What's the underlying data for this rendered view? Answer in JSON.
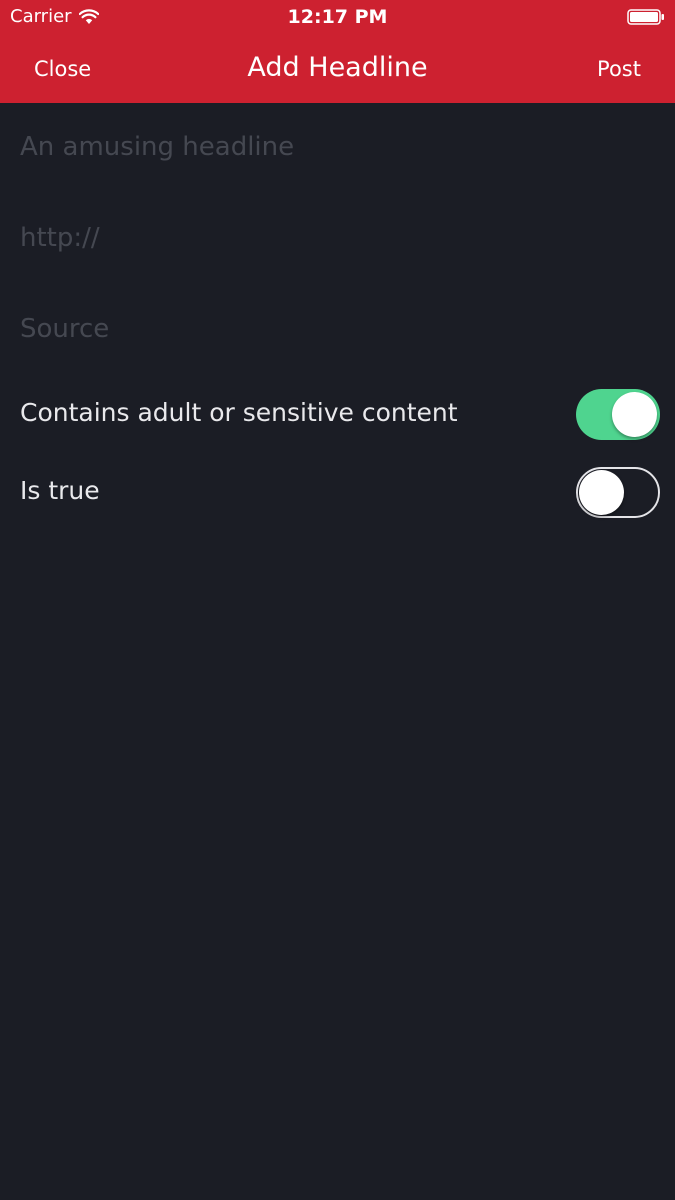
{
  "status_bar": {
    "carrier": "Carrier",
    "time": "12:17 PM",
    "wifi_icon": "wifi-icon",
    "battery_icon": "battery-icon"
  },
  "nav": {
    "close_label": "Close",
    "title": "Add Headline",
    "post_label": "Post"
  },
  "form": {
    "headline_placeholder": "An amusing headline",
    "headline_value": "",
    "url_placeholder": "http://",
    "url_value": "",
    "source_placeholder": "Source",
    "source_value": ""
  },
  "toggles": [
    {
      "label": "Contains adult or sensitive content",
      "on": true
    },
    {
      "label": "Is true",
      "on": false
    }
  ],
  "colors": {
    "header_red": "#cd2130",
    "background": "#1b1d25",
    "toggle_on_green": "#4fd48f",
    "placeholder": "#454851"
  }
}
